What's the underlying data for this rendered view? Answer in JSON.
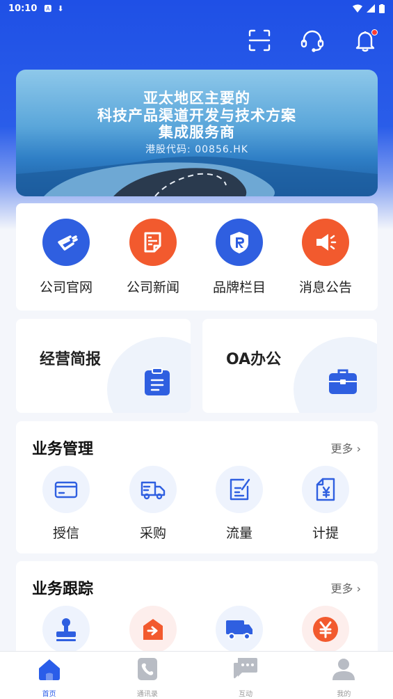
{
  "status_bar": {
    "time": "10:10"
  },
  "banner": {
    "line1": "亚太地区主要的",
    "line2": "科技产品渠道开发与技术方案",
    "line3": "集成服务商",
    "stock": "港股代码: 00856.HK"
  },
  "quick_links": [
    {
      "label": "公司官网",
      "icon": "website-icon",
      "color": "#2f5fe0"
    },
    {
      "label": "公司新闻",
      "icon": "news-icon",
      "color": "#f25a2e"
    },
    {
      "label": "品牌栏目",
      "icon": "brand-icon",
      "color": "#2f5fe0"
    },
    {
      "label": "消息公告",
      "icon": "announcement-icon",
      "color": "#f25a2e"
    }
  ],
  "cards": {
    "report": "经营简报",
    "oa": "OA办公"
  },
  "business": {
    "title": "业务管理",
    "more": "更多",
    "items": [
      {
        "label": "授信",
        "icon": "credit-card-icon"
      },
      {
        "label": "采购",
        "icon": "delivery-truck-icon"
      },
      {
        "label": "流量",
        "icon": "edit-document-icon"
      },
      {
        "label": "计提",
        "icon": "yuan-document-icon"
      }
    ]
  },
  "tracking": {
    "title": "业务跟踪",
    "more": "更多",
    "items": [
      {
        "icon": "stamp-icon"
      },
      {
        "icon": "export-icon"
      },
      {
        "icon": "truck-icon"
      },
      {
        "icon": "yuan-icon"
      }
    ]
  },
  "tabbar": [
    {
      "label": "首页",
      "icon": "home-icon",
      "active": true
    },
    {
      "label": "通讯录",
      "icon": "contacts-icon",
      "active": false
    },
    {
      "label": "互动",
      "icon": "chat-icon",
      "active": false
    },
    {
      "label": "我的",
      "icon": "profile-icon",
      "active": false
    }
  ],
  "colors": {
    "brand_blue": "#2a5de9",
    "accent_orange": "#f25a2e"
  }
}
